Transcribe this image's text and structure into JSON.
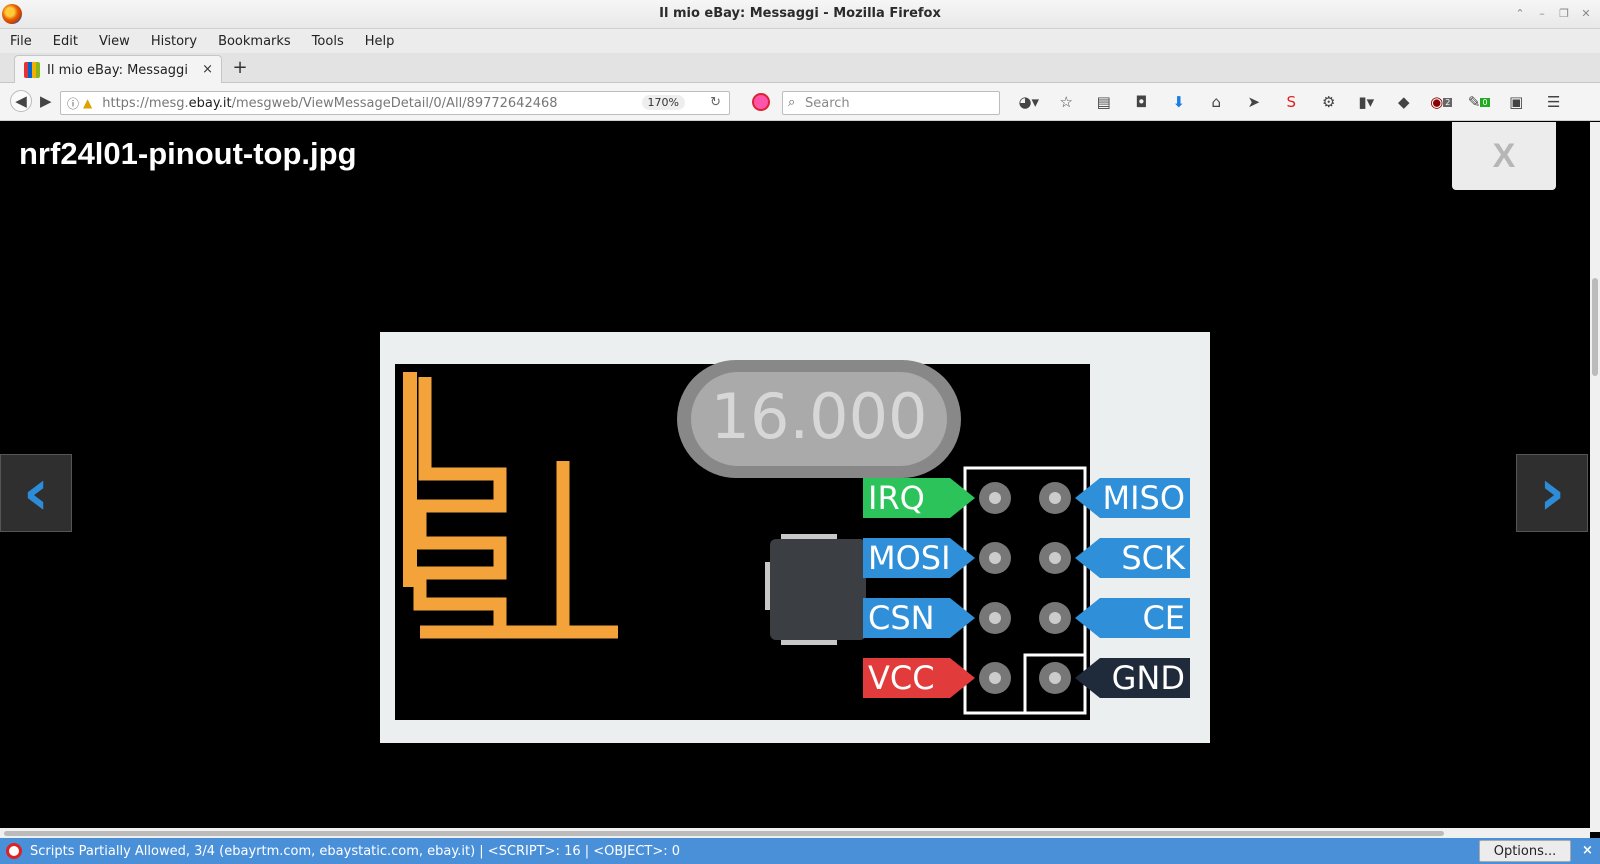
{
  "window": {
    "title": "Il mio eBay: Messaggi - Mozilla Firefox"
  },
  "menu": [
    "File",
    "Edit",
    "View",
    "History",
    "Bookmarks",
    "Tools",
    "Help"
  ],
  "tab": {
    "label": "Il mio eBay: Messaggi",
    "close": "×",
    "new": "+"
  },
  "nav": {
    "url_prefix": "https://mesg.",
    "url_domain": "ebay.it",
    "url_rest": "/mesgweb/ViewMessageDetail/0/All/89772642468",
    "zoom": "170%",
    "search_placeholder": "Search"
  },
  "toolbar_icons": [
    "sync-menu-icon",
    "bookmark-star-icon",
    "reading-list-icon",
    "pocket-icon",
    "download-icon",
    "home-icon",
    "send-icon",
    "noscript-icon",
    "extension-icon",
    "clipboard-icon",
    "chevron-down-icon",
    "arrow-icon",
    "ublock-icon",
    "addon-icon",
    "s-icon",
    "hamburger-menu-icon"
  ],
  "badges": {
    "ublock": "2",
    "addon": "0"
  },
  "viewer": {
    "title": "nrf24l01-pinout-top.jpg",
    "close": "X",
    "prev": "‹",
    "next": "›"
  },
  "image": {
    "crystal": "16.000",
    "left_pins": [
      "IRQ",
      "MOSI",
      "CSN",
      "VCC"
    ],
    "right_pins": [
      "MISO",
      "SCK",
      "CE",
      "GND"
    ],
    "colors": {
      "irq": "#2cc35a",
      "signal": "#2f8fd8",
      "vcc": "#e23b3b",
      "gnd": "#1f2a3a",
      "antenna": "#f3a33a"
    }
  },
  "status": {
    "text": "Scripts Partially Allowed, 3/4 (ebayrtm.com, ebaystatic.com, ebay.it) | <SCRIPT>: 16 | <OBJECT>: 0",
    "options": "Options...",
    "close": "×"
  }
}
